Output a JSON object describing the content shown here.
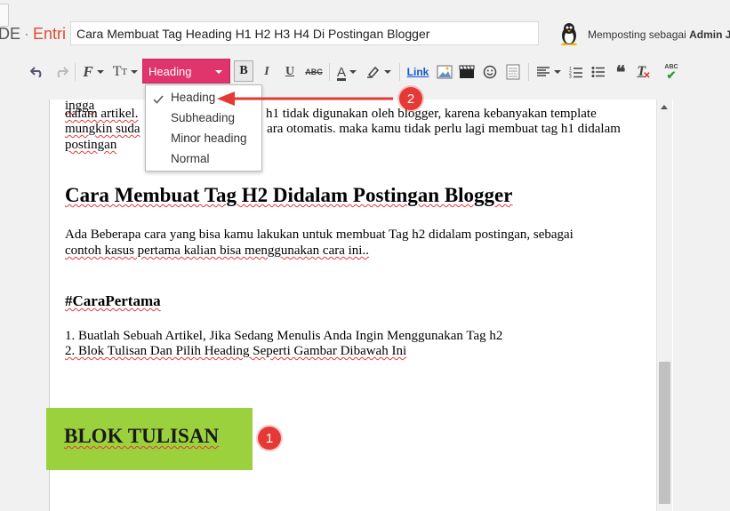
{
  "header": {
    "brand_prefix": "DE",
    "brand_sep": "·",
    "brand_entri": "Entri",
    "post_title": "Cara Membuat Tag Heading H1 H2 H3 H4 Di Postingan Blogger",
    "posting_as_label": "Memposting sebagai",
    "posting_as_user": "Admin J"
  },
  "toolbar": {
    "heading_select_value": "Heading",
    "bold_label": "B",
    "italic_label": "I",
    "underline_label": "U",
    "strike_label": "ABC",
    "link_label": "Link",
    "spell_label": "ABC"
  },
  "dropdown": {
    "items": [
      "Heading",
      "Subheading",
      "Minor heading",
      "Normal"
    ],
    "selected": "Heading"
  },
  "editor": {
    "para1_line1": "dalam artikel.",
    "para1_line1b": "h1 tidak digunakan oleh blogger, karena kebanyakan template",
    "para1_line2a": "mungkin suda",
    "para1_line2b": "ara otomatis. maka kamu tidak perlu lagi membuat tag h1 didalam",
    "para1_line3": "postingan",
    "h2": "Cara Membuat Tag H2 Didalam Postingan Blogger",
    "para2_line1": "Ada Beberapa cara yang bisa kamu lakukan untuk membuat Tag h2 didalam postingan, sebagai",
    "para2_line2": "contoh kasus pertama kalian bisa menggunakan cara ini..",
    "heading_cara": "#CaraPertama",
    "step1": "1. Buatlah Sebuah Artikel, Jika Sedang Menulis Anda Ingin Menggunakan Tag h2",
    "step2": "2. Blok Tulisan Dan Pilih Heading Seperti Gambar Dibawah Ini",
    "blok_text": "BLOK TULISAN"
  },
  "annotations": {
    "badge1": "1",
    "badge2": "2"
  },
  "colors": {
    "heading_select_bg": "#e0356c",
    "highlight_green": "#9bd13d",
    "badge_red": "#e53935",
    "brand_accent": "#dd4b39"
  }
}
